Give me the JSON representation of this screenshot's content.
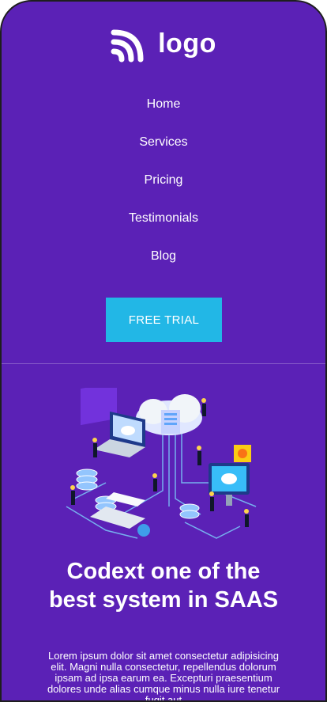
{
  "brand": {
    "logo_text": "logo"
  },
  "nav": {
    "items": [
      {
        "label": "Home"
      },
      {
        "label": "Services"
      },
      {
        "label": "Pricing"
      },
      {
        "label": "Testimonials"
      },
      {
        "label": "Blog"
      }
    ]
  },
  "cta": {
    "label": "FREE TRIAL"
  },
  "hero": {
    "title_line1": "Codext one of the",
    "title_line2": "best system in SAAS",
    "description": "Lorem ipsum dolor sit amet consectetur adipisicing elit. Magni nulla consectetur, repellendus dolorum ipsam ad ipsa earum ea. Excepturi praesentium dolores unde alias cumque minus nulla iure tenetur fugit aut"
  },
  "colors": {
    "background": "#5b21b6",
    "cta": "#22b7e6",
    "text": "#ffffff"
  },
  "icons": {
    "logo": "wifi-rss-logo-icon",
    "illustration": "isometric-cloud-saas-illustration"
  }
}
